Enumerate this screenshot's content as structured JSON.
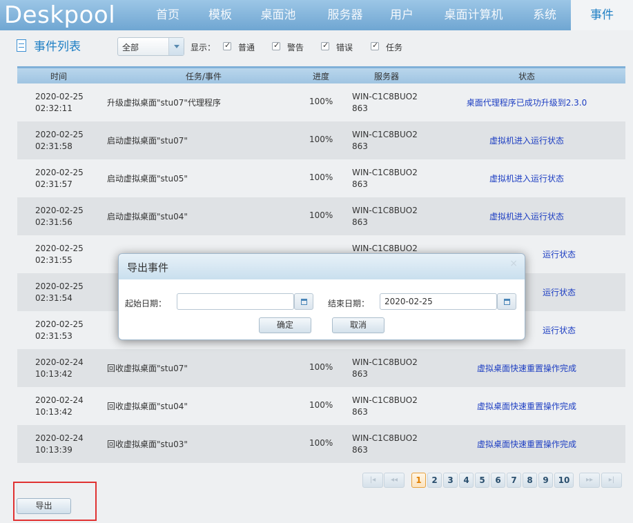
{
  "app": {
    "logo": "Deskpool"
  },
  "nav": {
    "items": [
      "首页",
      "模板",
      "桌面池",
      "服务器",
      "用户",
      "桌面计算机",
      "系统",
      "事件"
    ],
    "active": "事件"
  },
  "toolbar": {
    "title": "事件列表",
    "filter_value": "全部",
    "show_label": "显示：",
    "checkboxes": [
      {
        "label": "普通",
        "checked": true
      },
      {
        "label": "警告",
        "checked": true
      },
      {
        "label": "错误",
        "checked": true
      },
      {
        "label": "任务",
        "checked": true
      }
    ]
  },
  "table": {
    "columns": [
      "时间",
      "任务/事件",
      "进度",
      "服务器",
      "状态"
    ],
    "rows": [
      {
        "date": "2020-02-25",
        "time": "02:32:11",
        "task": "升级虚拟桌面\"stu07\"代理程序",
        "progress": "100%",
        "server1": "WIN-C1C8BUO2",
        "server2": "863",
        "status": "桌面代理程序已成功升级到2.3.0"
      },
      {
        "date": "2020-02-25",
        "time": "02:31:58",
        "task": "启动虚拟桌面\"stu07\"",
        "progress": "100%",
        "server1": "WIN-C1C8BUO2",
        "server2": "863",
        "status": "虚拟机进入运行状态"
      },
      {
        "date": "2020-02-25",
        "time": "02:31:57",
        "task": "启动虚拟桌面\"stu05\"",
        "progress": "100%",
        "server1": "WIN-C1C8BUO2",
        "server2": "863",
        "status": "虚拟机进入运行状态"
      },
      {
        "date": "2020-02-25",
        "time": "02:31:56",
        "task": "启动虚拟桌面\"stu04\"",
        "progress": "100%",
        "server1": "WIN-C1C8BUO2",
        "server2": "863",
        "status": "虚拟机进入运行状态"
      },
      {
        "date": "2020-02-25",
        "time": "02:31:55",
        "task": "",
        "progress": "",
        "server1": "WIN-C1C8BUO2",
        "server2": "",
        "status": "运行状态"
      },
      {
        "date": "2020-02-25",
        "time": "02:31:54",
        "task": "",
        "progress": "",
        "server1": "",
        "server2": "",
        "status": "运行状态"
      },
      {
        "date": "2020-02-25",
        "time": "02:31:53",
        "task": "",
        "progress": "",
        "server1": "",
        "server2": "",
        "status": "运行状态"
      },
      {
        "date": "2020-02-24",
        "time": "10:13:42",
        "task": "回收虚拟桌面\"stu07\"",
        "progress": "100%",
        "server1": "WIN-C1C8BUO2",
        "server2": "863",
        "status": "虚拟桌面快速重置操作完成"
      },
      {
        "date": "2020-02-24",
        "time": "10:13:42",
        "task": "回收虚拟桌面\"stu04\"",
        "progress": "100%",
        "server1": "WIN-C1C8BUO2",
        "server2": "863",
        "status": "虚拟桌面快速重置操作完成"
      },
      {
        "date": "2020-02-24",
        "time": "10:13:39",
        "task": "回收虚拟桌面\"stu03\"",
        "progress": "100%",
        "server1": "WIN-C1C8BUO2",
        "server2": "863",
        "status": "虚拟桌面快速重置操作完成"
      }
    ]
  },
  "pagination": {
    "first": "|◂",
    "prev": "◂◂",
    "pages": [
      "1",
      "2",
      "3",
      "4",
      "5",
      "6",
      "7",
      "8",
      "9",
      "10"
    ],
    "current": "1",
    "next": "▸▸",
    "last": "▸|"
  },
  "export_button": "导出",
  "dialog": {
    "title": "导出事件",
    "close": "×",
    "start_label": "起始日期：",
    "start_value": "",
    "end_label": "结束日期：",
    "end_value": "2020-02-25",
    "ok": "确定",
    "cancel": "取消"
  },
  "colors": {
    "nav_bg": "#7fb2da",
    "accent": "#1f7fc4",
    "status_link": "#1d3ec2",
    "highlight": "#e03131"
  }
}
